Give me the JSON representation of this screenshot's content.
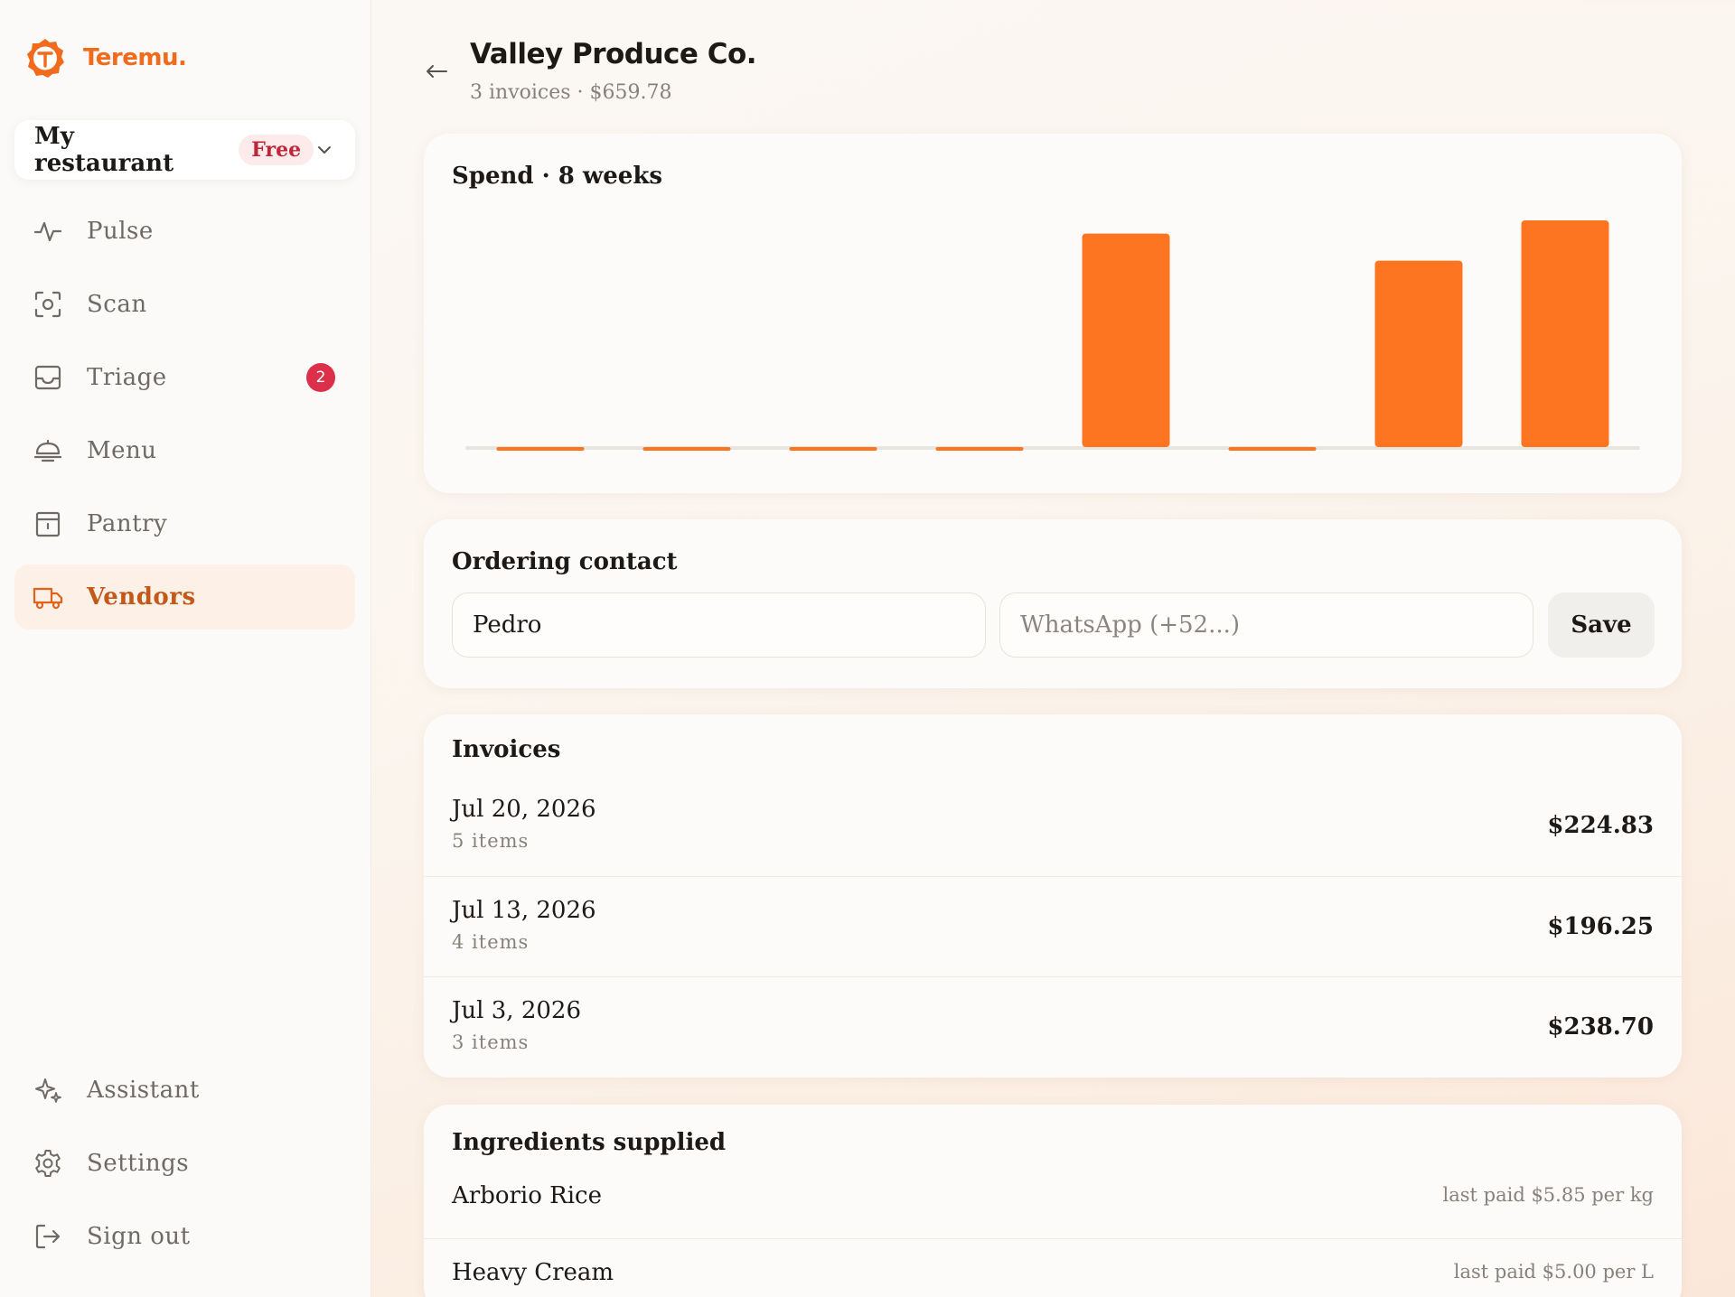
{
  "brand": {
    "name": "Teremu.",
    "logo_icon": "teremu-t-logo-icon",
    "accent": "#f26a1b"
  },
  "workspace": {
    "name": "My restaurant",
    "plan_badge": "Free"
  },
  "nav": {
    "items": [
      {
        "label": "Pulse",
        "icon": "pulse-icon"
      },
      {
        "label": "Scan",
        "icon": "scan-icon"
      },
      {
        "label": "Triage",
        "icon": "inbox-icon",
        "badge": "2"
      },
      {
        "label": "Menu",
        "icon": "menu-cloche-icon"
      },
      {
        "label": "Pantry",
        "icon": "pantry-box-icon"
      },
      {
        "label": "Vendors",
        "icon": "truck-icon",
        "active": true
      }
    ],
    "bottom": [
      {
        "label": "Assistant",
        "icon": "sparkles-icon"
      },
      {
        "label": "Settings",
        "icon": "gear-icon"
      },
      {
        "label": "Sign out",
        "icon": "sign-out-icon"
      }
    ]
  },
  "header": {
    "title": "Valley Produce Co.",
    "subtitle": "3 invoices · $659.78"
  },
  "spend_card": {
    "title": "Spend · 8 weeks"
  },
  "chart_data": {
    "type": "bar",
    "series": [
      {
        "values": [
          0,
          0,
          0,
          0,
          224.83,
          0,
          196.25,
          238.7
        ]
      }
    ],
    "color": "#fe7521",
    "baseline_color": "#e8e4df",
    "ylim": [
      0,
      238.7
    ],
    "grid": false
  },
  "contact": {
    "title": "Ordering contact",
    "name_value": "Pedro",
    "phone_placeholder": "WhatsApp (+52...)",
    "save_label": "Save"
  },
  "invoices": {
    "title": "Invoices",
    "rows": [
      {
        "date": "Jul 20, 2026",
        "items": "5 items",
        "amount": "$224.83"
      },
      {
        "date": "Jul 13, 2026",
        "items": "4 items",
        "amount": "$196.25"
      },
      {
        "date": "Jul 3, 2026",
        "items": "3 items",
        "amount": "$238.70"
      }
    ]
  },
  "ingredients": {
    "title": "Ingredients supplied",
    "rows": [
      {
        "name": "Arborio Rice",
        "price": "last paid $5.85 per kg"
      },
      {
        "name": "Heavy Cream",
        "price": "last paid $5.00 per L"
      }
    ]
  }
}
